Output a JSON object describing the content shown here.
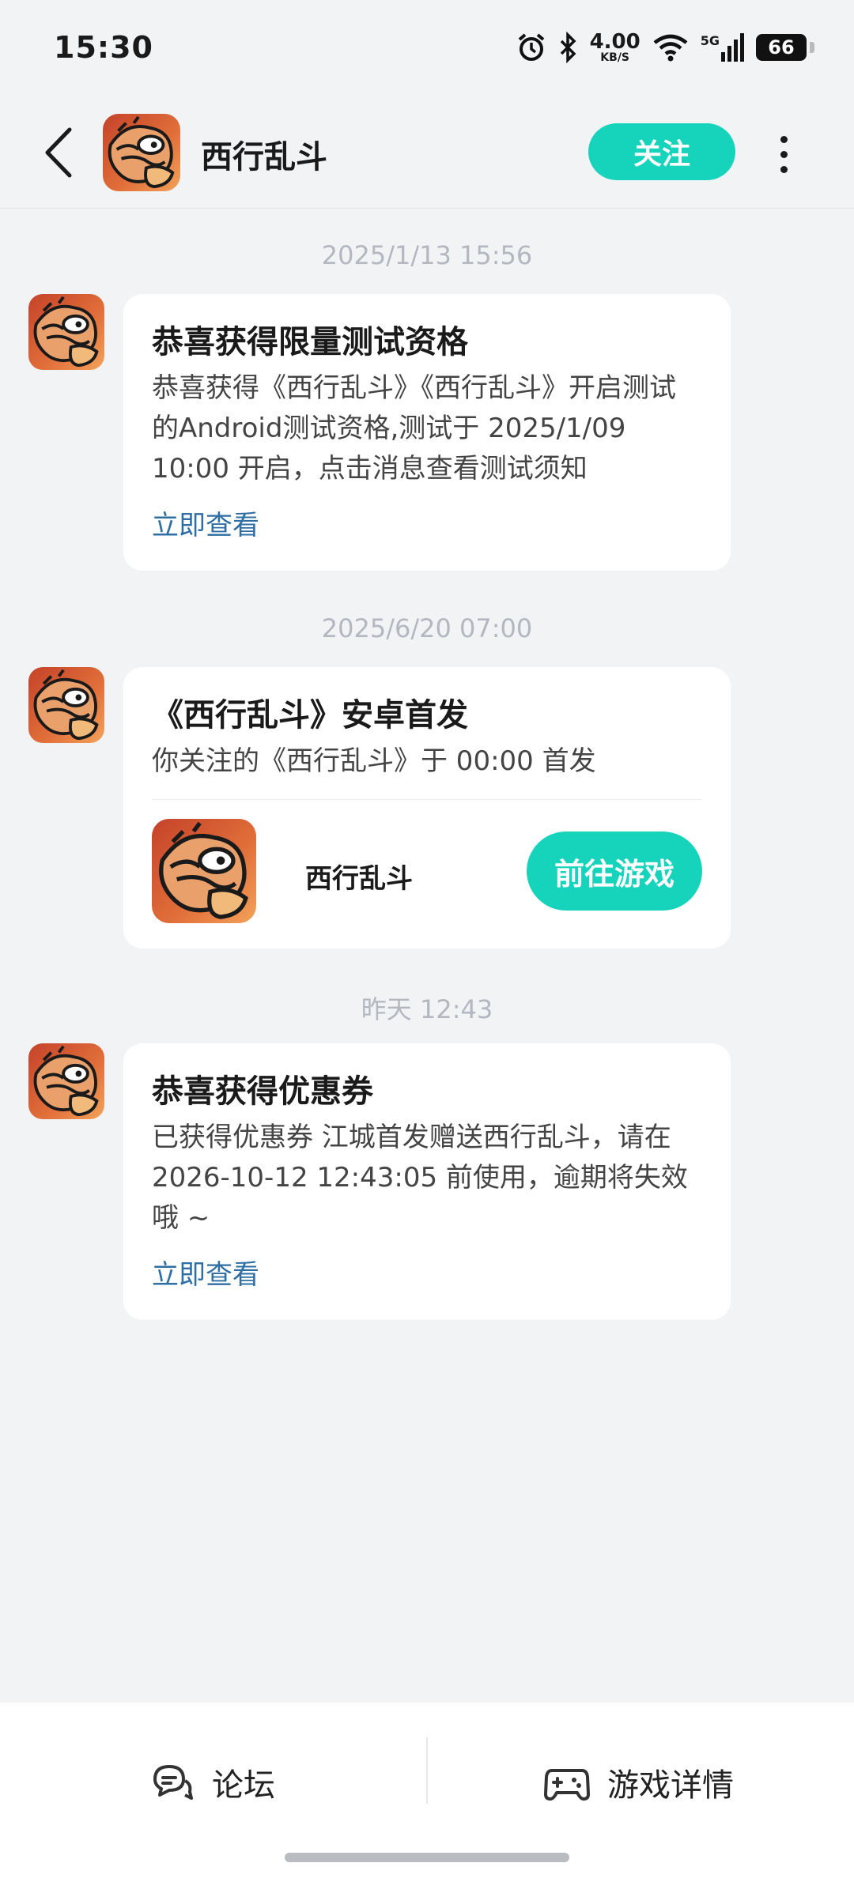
{
  "status_bar": {
    "time": "15:30",
    "net_speed_value": "4.00",
    "net_speed_unit": "KB/S",
    "network_type": "5G",
    "battery": "66",
    "icons": [
      "alarm-icon",
      "bluetooth-icon",
      "wifi-icon",
      "signal-icon",
      "battery-icon"
    ]
  },
  "header": {
    "title": "西行乱斗",
    "follow_label": "关注",
    "back_icon": "chevron-left-icon",
    "more_icon": "more-vertical-icon"
  },
  "messages": [
    {
      "timestamp": "2025/1/13  15:56",
      "title": "恭喜获得限量测试资格",
      "body": "恭喜获得《西行乱斗》《西行乱斗》开启测试的Android测试资格,测试于 2025/1/09 10:00 开启，点击消息查看测试须知",
      "link": "立即查看"
    },
    {
      "timestamp": "2025/6/20  07:00",
      "title": "《西行乱斗》安卓首发",
      "body": "你关注的《西行乱斗》于 00:00 首发",
      "game_name": "西行乱斗",
      "button": "前往游戏"
    },
    {
      "timestamp": "昨天  12:43",
      "title": "恭喜获得优惠券",
      "body": "已获得优惠券 江城首发赠送西行乱斗，请在2026-10-12 12:43:05 前使用，逾期将失效哦 ~",
      "link": "立即查看"
    }
  ],
  "bottom_bar": {
    "forum_label": "论坛",
    "game_detail_label": "游戏详情"
  },
  "colors": {
    "accent": "#16d3bc",
    "link": "#2f6ea3",
    "background": "#f2f3f5"
  }
}
